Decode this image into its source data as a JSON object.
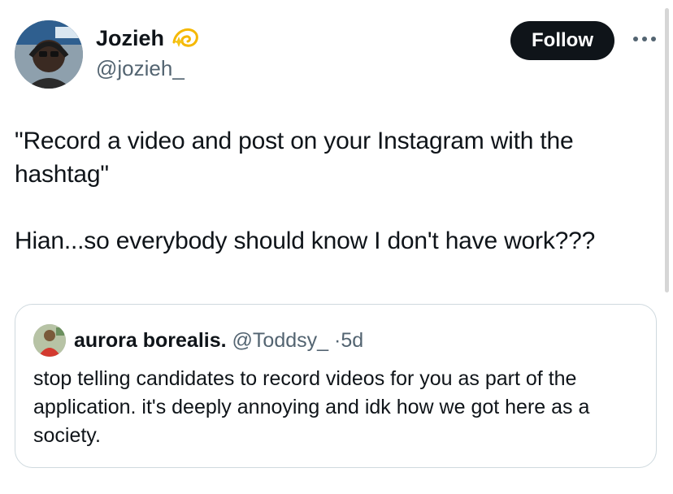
{
  "author": {
    "name": "Jozieh",
    "handle": "@jozieh_",
    "name_emoji": "dizzy-icon"
  },
  "follow_label": "Follow",
  "more_icon": "more-horizontal-icon",
  "tweet": {
    "line1": "\"Record a video and post on your Instagram with the hashtag\"",
    "line2": "Hian...so everybody should know I don't have work???"
  },
  "quote": {
    "name": "aurora borealis.",
    "handle": "@Toddsy_",
    "separator": "·",
    "time": "5d",
    "text": "stop telling candidates to record videos for you as part of the application. it's deeply annoying and idk how we got here as a society."
  },
  "colors": {
    "text": "#0f1419",
    "secondary": "#536471",
    "border": "#cfd9de",
    "button": "#0f1419",
    "emoji": "#f5c518"
  }
}
